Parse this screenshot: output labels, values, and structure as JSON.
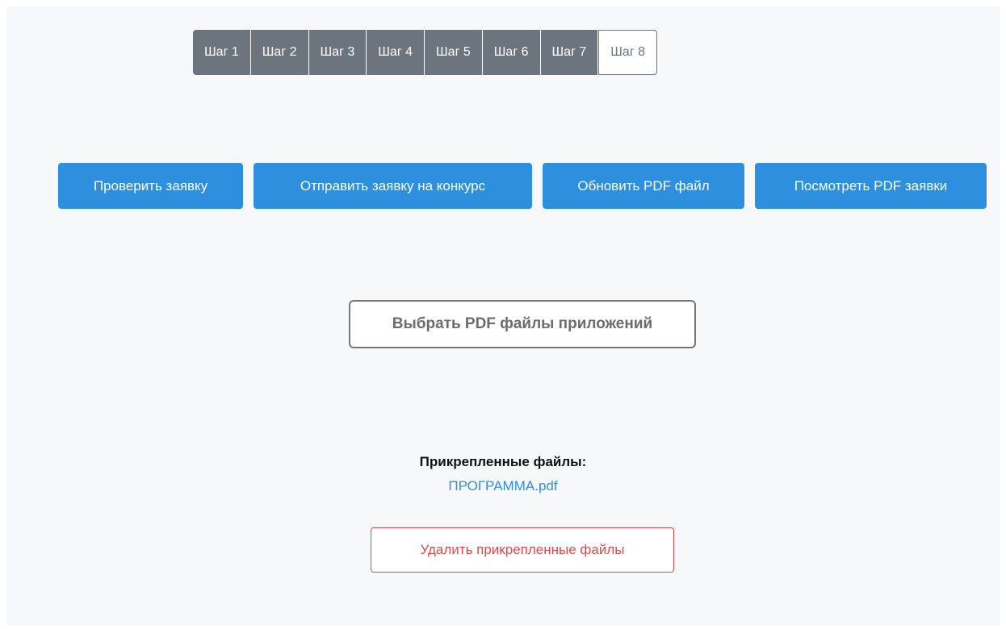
{
  "steps": [
    {
      "label": "Шаг 1"
    },
    {
      "label": "Шаг 2"
    },
    {
      "label": "Шаг 3"
    },
    {
      "label": "Шаг 4"
    },
    {
      "label": "Шаг 5"
    },
    {
      "label": "Шаг 6"
    },
    {
      "label": "Шаг 7"
    },
    {
      "label": "Шаг 8"
    }
  ],
  "actions": {
    "check_label": "Проверить заявку",
    "submit_label": "Отправить заявку на конкурс",
    "refresh_label": "Обновить PDF файл",
    "view_label": "Посмотреть PDF заявки"
  },
  "choose_files_label": "Выбрать PDF файлы приложений",
  "attached": {
    "title": "Прикрепленные файлы:",
    "files": [
      {
        "name": "ПРОГРАММА.pdf"
      }
    ]
  },
  "delete_label": "Удалить прикрепленные файлы",
  "colors": {
    "primary": "#2f8fdf",
    "secondary": "#6c757d",
    "danger": "#e0484a",
    "background": "#f7f8fa"
  }
}
